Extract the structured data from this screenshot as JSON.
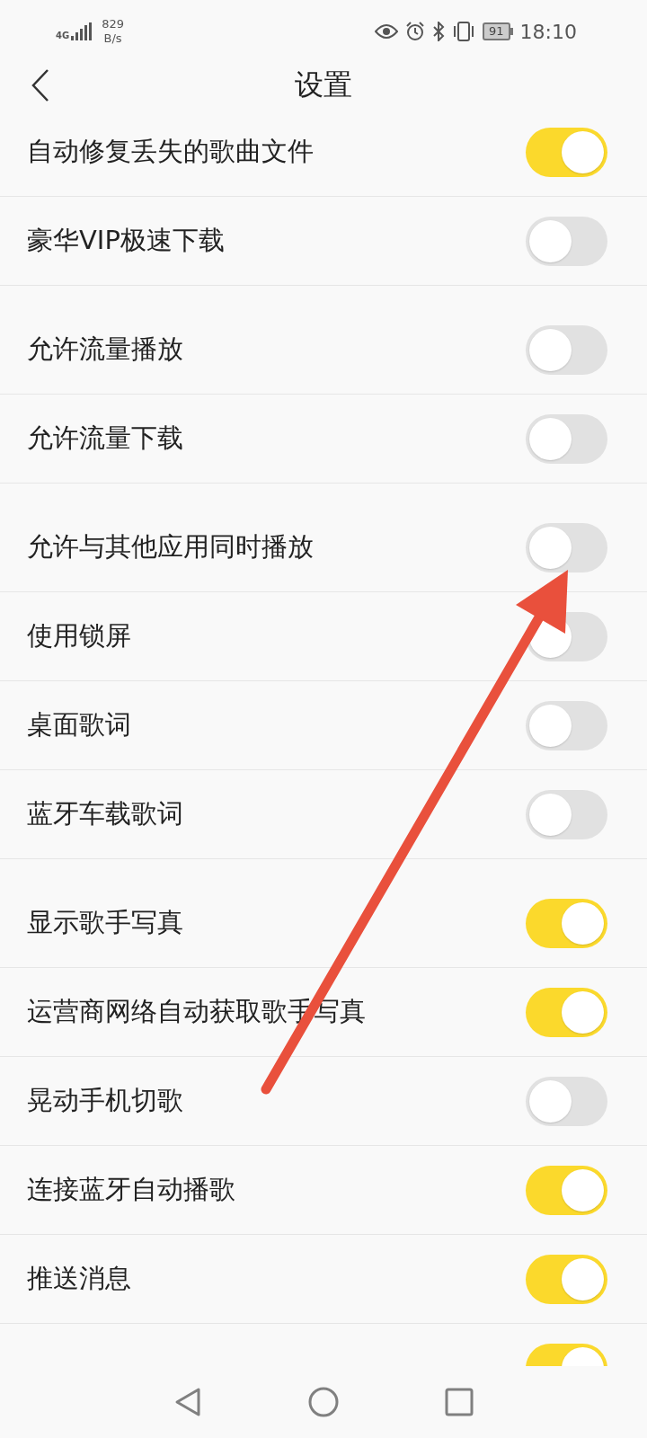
{
  "status_bar": {
    "network": "4G",
    "speed": "829",
    "speed_unit": "B/s",
    "battery": "91",
    "time": "18:10"
  },
  "header": {
    "title": "设置"
  },
  "groups": [
    {
      "items": [
        {
          "label": "自动修复丢失的歌曲文件",
          "on": true
        },
        {
          "label": "豪华VIP极速下载",
          "on": false
        }
      ]
    },
    {
      "items": [
        {
          "label": "允许流量播放",
          "on": false
        },
        {
          "label": "允许流量下载",
          "on": false
        }
      ]
    },
    {
      "items": [
        {
          "label": "允许与其他应用同时播放",
          "on": false
        },
        {
          "label": "使用锁屏",
          "on": false
        },
        {
          "label": "桌面歌词",
          "on": false
        },
        {
          "label": "蓝牙车载歌词",
          "on": false
        }
      ]
    },
    {
      "items": [
        {
          "label": "显示歌手写真",
          "on": true
        },
        {
          "label": "运营商网络自动获取歌手写真",
          "on": true
        },
        {
          "label": "晃动手机切歌",
          "on": false
        },
        {
          "label": "连接蓝牙自动播歌",
          "on": true
        },
        {
          "label": "推送消息",
          "on": true
        },
        {
          "on": true
        }
      ]
    }
  ]
}
